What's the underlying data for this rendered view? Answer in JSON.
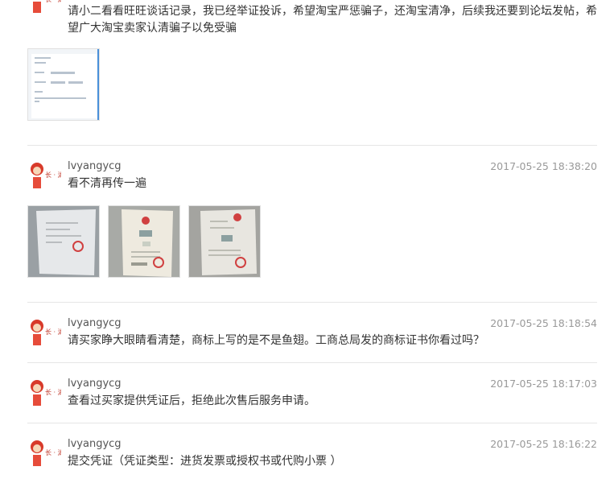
{
  "top_message": "请小二看看旺旺谈话记录，我已经举证投诉，希望淘宝严惩骗子，还淘宝清净，后续我还要到论坛发帖，希望广大淘宝卖家认清骗子以免受骗",
  "entries": [
    {
      "user": "lvyangycg",
      "time": "2017-05-25 18:38:20",
      "text": "看不清再传一遍"
    },
    {
      "user": "lvyangycg",
      "time": "2017-05-25 18:18:54",
      "text": "请买家睁大眼睛看清楚，商标上写的是不是鱼翅。工商总局发的商标证书你看过吗？"
    },
    {
      "user": "lvyangycg",
      "time": "2017-05-25 18:17:03",
      "text": "查看过买家提供凭证后，拒绝此次售后服务申请。"
    },
    {
      "user": "lvyangycg",
      "time": "2017-05-25 18:16:22",
      "text": "提交凭证（凭证类型：进货发票或授权书或代购小票 ）"
    }
  ],
  "avatar_icon": "merchant-mascot-avatar-icon",
  "colors": {
    "divider": "#e6e6e6",
    "time": "#999999",
    "text": "#333333"
  }
}
